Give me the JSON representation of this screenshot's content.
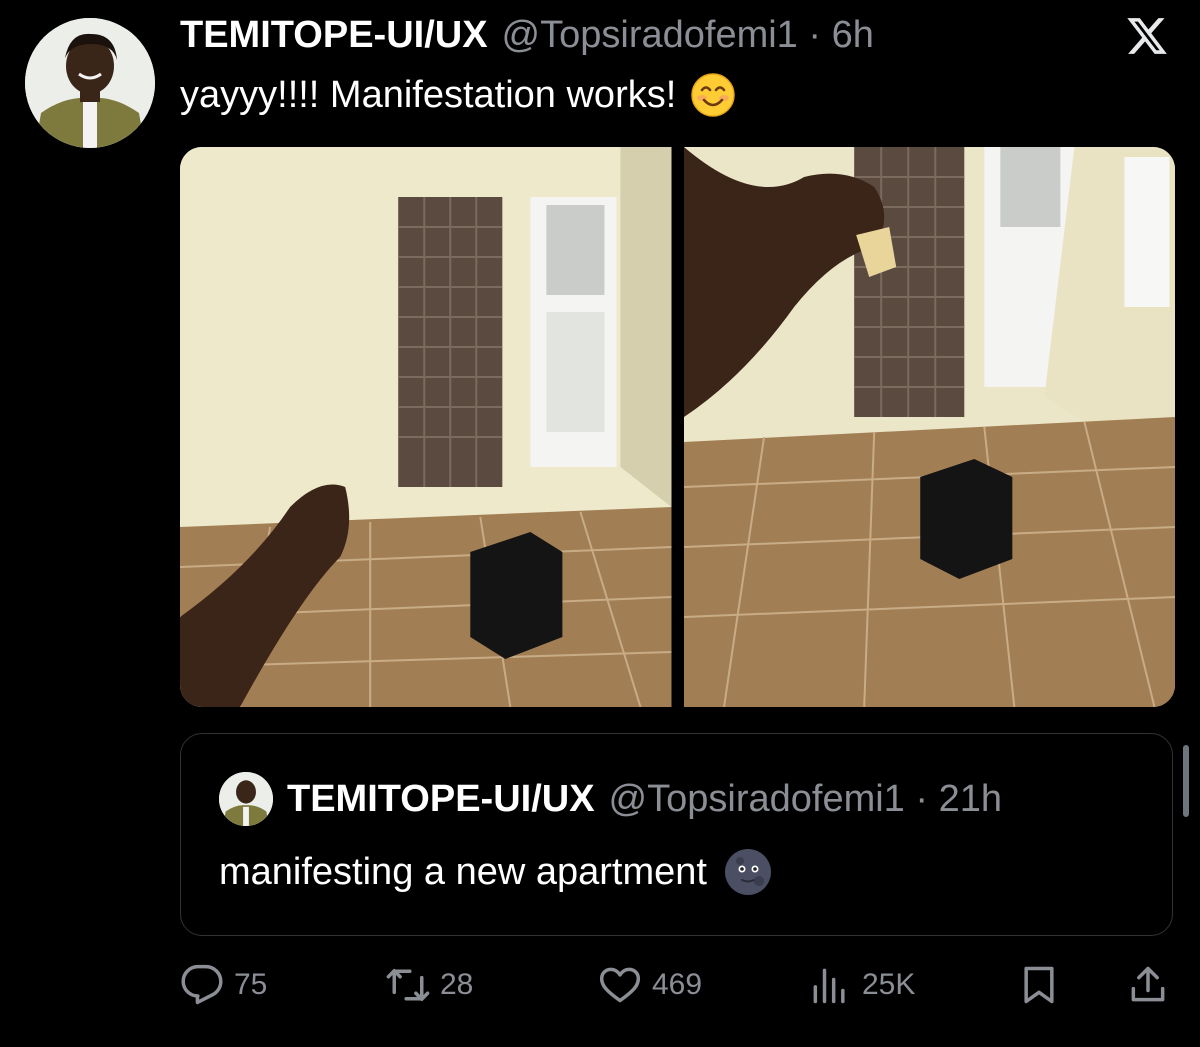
{
  "tweet": {
    "author_name": "TEMITOPE-UI/UX",
    "author_handle_time": "@Topsiradofemi1 · 6h",
    "text": "yayyy!!!! Manifestation works!",
    "emoji": "smiling-face-icon"
  },
  "quoted_tweet": {
    "author_name": "TEMITOPE-UI/UX",
    "author_handle_time": "@Topsiradofemi1 · 21h",
    "text": "manifesting a new apartment",
    "emoji": "new-moon-face-icon"
  },
  "actions": {
    "replies": "75",
    "reposts": "28",
    "likes": "469",
    "views": "25K"
  },
  "colors": {
    "background": "#000000",
    "text": "#ffffff",
    "secondary": "#8b8f95",
    "border": "#2f3336"
  }
}
